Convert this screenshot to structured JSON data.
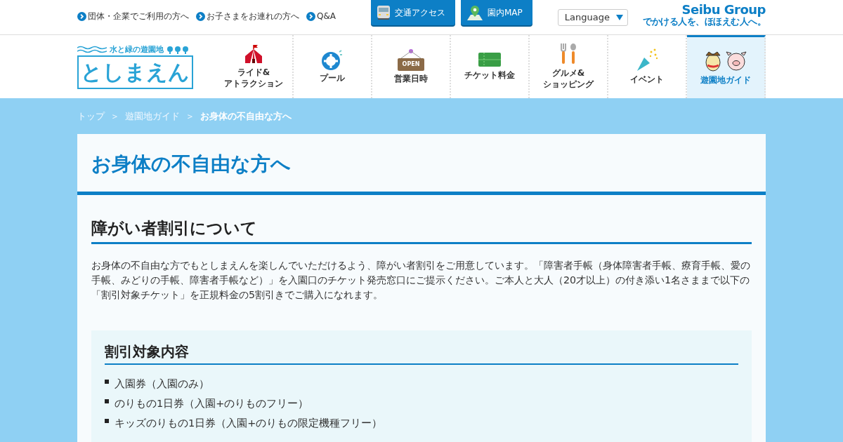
{
  "top_links": [
    {
      "label": "団体・企業でご利用の方へ"
    },
    {
      "label": "お子さまをお連れの方へ"
    },
    {
      "label": "Q&A"
    }
  ],
  "top_buttons": [
    {
      "kind": "train",
      "label": "交通アクセス"
    },
    {
      "kind": "map",
      "label": "園内MAP"
    }
  ],
  "language": {
    "label": "Language"
  },
  "group_logo": {
    "name": "Seibu Group",
    "tagline": "でかける人を、ほほえむ人へ。"
  },
  "logo": {
    "tagline": "水と緑の遊園地",
    "name": "としまえん"
  },
  "nav": [
    {
      "kind": "tent",
      "label": "ライド&\nアトラクション",
      "selected": false
    },
    {
      "kind": "ring",
      "label": "プール",
      "selected": false
    },
    {
      "kind": "open",
      "label": "営業日時",
      "selected": false,
      "sign": "OPEN"
    },
    {
      "kind": "ticket",
      "label": "チケット料金",
      "selected": false
    },
    {
      "kind": "cutlery",
      "label": "グルメ&\nショッピング",
      "selected": false
    },
    {
      "kind": "popper",
      "label": "イベント",
      "selected": false
    },
    {
      "kind": "mascots",
      "label": "遊園地ガイド",
      "selected": true
    }
  ],
  "breadcrumb": [
    {
      "label": "トップ",
      "current": false
    },
    {
      "label": "遊園地ガイド",
      "current": false
    },
    {
      "label": "お身体の不自由な方へ",
      "current": true
    }
  ],
  "breadcrumb_separator": "＞",
  "page_title": "お身体の不自由な方へ",
  "section": {
    "heading": "障がい者割引について",
    "body": "お身体の不自由な方でもとしまえんを楽しんでいただけるよう、障がい者割引をご用意しています。「障害者手帳（身体障害者手帳、療育手帳、愛の手帳、みどりの手帳、障害者手帳など）」を入園口のチケット発売窓口にご提示ください。ご本人と大人（20才以上）の付き添い1名さままで以下の「割引対象チケット」を正規料金の5割引きでご購入になれます。"
  },
  "discount": {
    "heading": "割引対象内容",
    "items": [
      "入園券（入園のみ）",
      "のりもの1日券（入園+のりものフリー）",
      "キッズのりもの1日券（入園+のりもの限定機種フリー）"
    ]
  }
}
